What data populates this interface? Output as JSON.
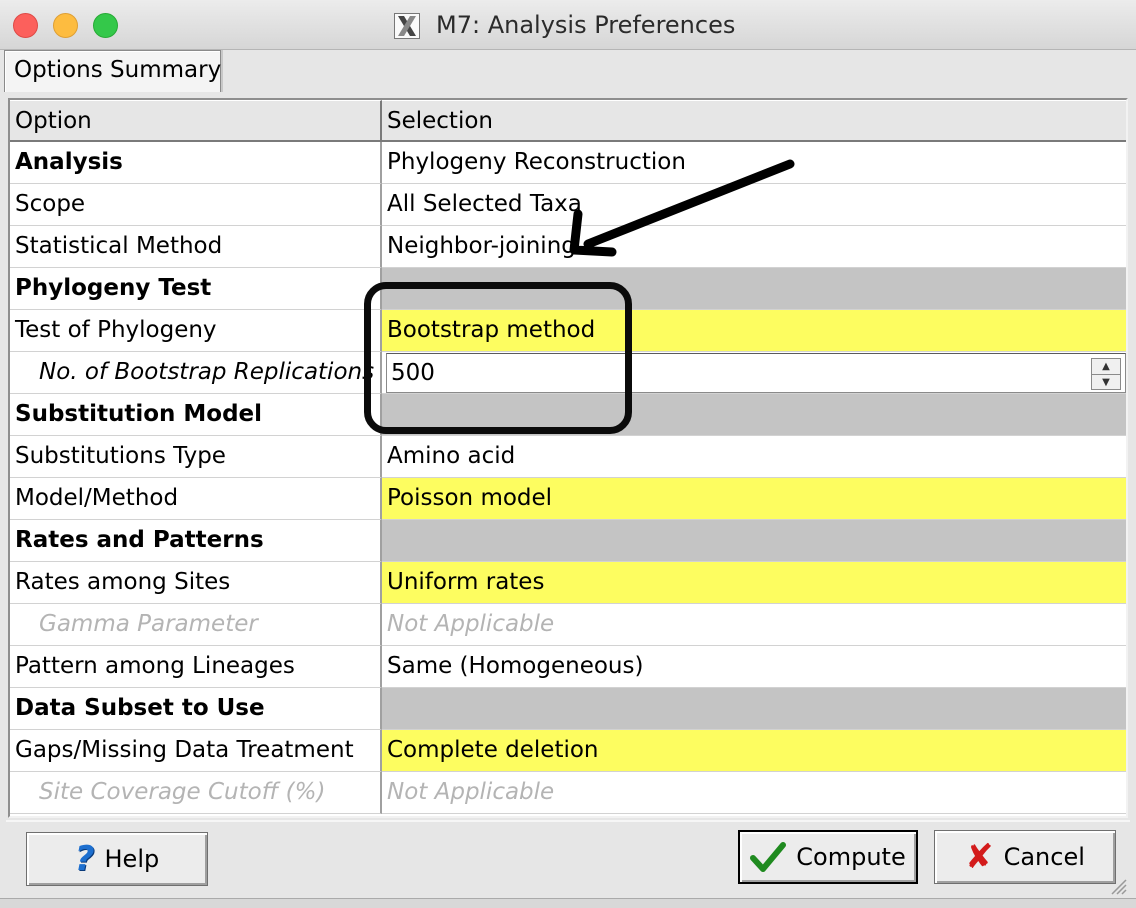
{
  "window": {
    "title": "M7: Analysis Preferences",
    "app_icon": "x-window-icon"
  },
  "tabs": [
    {
      "label": "Options Summary",
      "active": true
    }
  ],
  "table": {
    "headers": {
      "option": "Option",
      "selection": "Selection"
    },
    "rows": [
      {
        "option": "Analysis",
        "selection": "Phylogeny Reconstruction",
        "style": "section-bold",
        "fill": "white"
      },
      {
        "option": "Scope",
        "selection": "All Selected Taxa",
        "style": "normal",
        "fill": "white"
      },
      {
        "option": "Statistical Method",
        "selection": "Neighbor-joining",
        "style": "normal",
        "fill": "white"
      },
      {
        "option": "Phylogeny Test",
        "selection": "",
        "style": "section-bold",
        "fill": "gray"
      },
      {
        "option": "Test of Phylogeny",
        "selection": "Bootstrap method",
        "style": "normal",
        "fill": "yellow"
      },
      {
        "option": "No. of Bootstrap Replications",
        "selection": "500",
        "style": "indent",
        "fill": "white",
        "control": "spinner"
      },
      {
        "option": "Substitution Model",
        "selection": "",
        "style": "section-bold",
        "fill": "gray"
      },
      {
        "option": "Substitutions Type",
        "selection": "Amino acid",
        "style": "normal",
        "fill": "white"
      },
      {
        "option": "Model/Method",
        "selection": "Poisson model",
        "style": "normal",
        "fill": "yellow"
      },
      {
        "option": "Rates and Patterns",
        "selection": "",
        "style": "section-bold",
        "fill": "gray"
      },
      {
        "option": "Rates among Sites",
        "selection": "Uniform rates",
        "style": "normal",
        "fill": "yellow"
      },
      {
        "option": "Gamma Parameter",
        "selection": "Not Applicable",
        "style": "disabled",
        "fill": "white"
      },
      {
        "option": "Pattern among Lineages",
        "selection": "Same (Homogeneous)",
        "style": "normal",
        "fill": "white"
      },
      {
        "option": "Data Subset to Use",
        "selection": "",
        "style": "section-bold",
        "fill": "gray"
      },
      {
        "option": "Gaps/Missing Data Treatment",
        "selection": "Complete deletion",
        "style": "normal",
        "fill": "yellow"
      },
      {
        "option": "Site Coverage Cutoff (%)",
        "selection": "Not Applicable",
        "style": "disabled",
        "fill": "white"
      }
    ]
  },
  "buttons": {
    "help": {
      "label": "Help",
      "icon": "question-mark-icon"
    },
    "compute": {
      "label": "Compute",
      "icon": "checkmark-icon"
    },
    "cancel": {
      "label": "Cancel",
      "icon": "x-mark-icon"
    }
  },
  "colors": {
    "highlight_yellow": "#fdfd60",
    "section_gray": "#c4c4c4",
    "disabled_text": "#b4b4b4"
  }
}
